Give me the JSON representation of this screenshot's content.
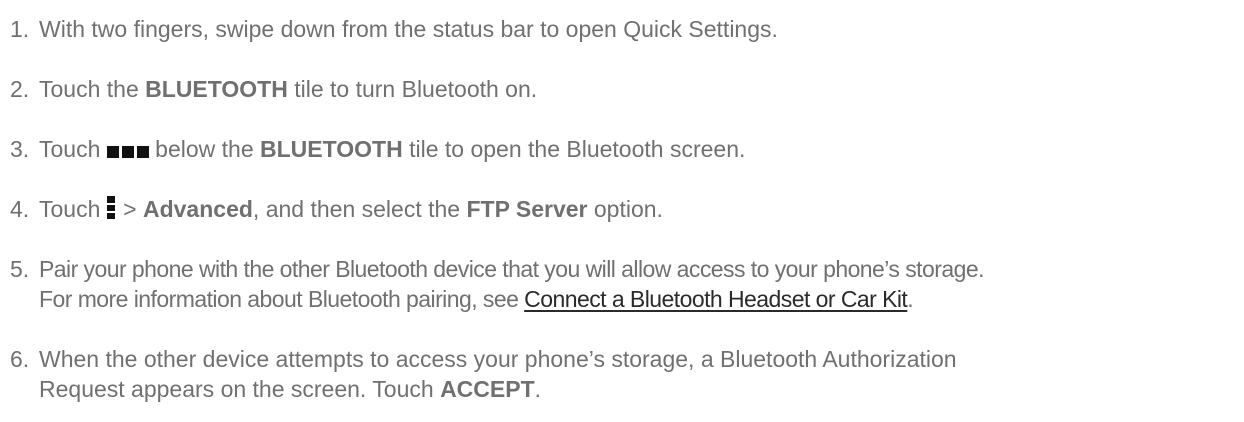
{
  "steps": [
    {
      "num": "1.",
      "text": "With two fingers, swipe down from the status bar to open Quick Settings."
    },
    {
      "num": "2.",
      "before": "Touch the ",
      "bold": "BLUETOOTH",
      "after": " tile to turn Bluetooth on."
    },
    {
      "num": "3.",
      "before": "Touch ",
      "icon": "more-dots-icon",
      "middle": " below the ",
      "bold": "BLUETOOTH",
      "after": " tile to open the Bluetooth screen."
    },
    {
      "num": "4.",
      "before": "Touch ",
      "icon": "menu-vertical-icon",
      "middle": " > ",
      "bold": "Advanced",
      "mid2": ", and then select the ",
      "bold2": "FTP Server",
      "after": " option."
    },
    {
      "num": "5.",
      "line1": "Pair your phone with the other Bluetooth device that you will allow access to your phone’s storage.",
      "line2_before": "For more information about Bluetooth pairing, see ",
      "link": "Connect a Bluetooth Headset or Car Kit",
      "line2_after": "."
    },
    {
      "num": "6.",
      "line1": "When the other device attempts to access your phone’s storage, a Bluetooth Authorization",
      "line2_before": "Request appears on the screen. Touch ",
      "bold": "ACCEPT",
      "line2_after": "."
    }
  ]
}
